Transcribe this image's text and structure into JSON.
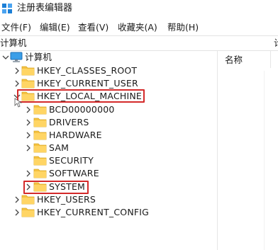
{
  "window": {
    "title": "注册表编辑器"
  },
  "menu": [
    {
      "label": "文件(F)"
    },
    {
      "label": "编辑(E)"
    },
    {
      "label": "查看(V)"
    },
    {
      "label": "收藏夹(A)"
    },
    {
      "label": "帮助(H)"
    }
  ],
  "address": {
    "path": "计算机",
    "right_fragment": "计"
  },
  "tree": {
    "root": {
      "label": "计算机",
      "expanded": true
    },
    "hives": {
      "classes_root": "HKEY_CLASSES_ROOT",
      "current_user": "HKEY_CURRENT_USER",
      "local_machine": "HKEY_LOCAL_MACHINE",
      "users": "HKEY_USERS",
      "current_config": "HKEY_CURRENT_CONFIG"
    },
    "local_machine_children": {
      "bcd": "BCD00000000",
      "drivers": "DRIVERS",
      "hardware": "HARDWARE",
      "sam": "SAM",
      "security": "SECURITY",
      "software": "SOFTWARE",
      "system": "SYSTEM"
    }
  },
  "rightpane": {
    "name_column": "名称"
  },
  "colors": {
    "highlight": "#d42a2a",
    "folder": "#f5c242",
    "app_icon": "#1c7fd6"
  },
  "highlighted": [
    "HKEY_LOCAL_MACHINE",
    "SYSTEM"
  ]
}
